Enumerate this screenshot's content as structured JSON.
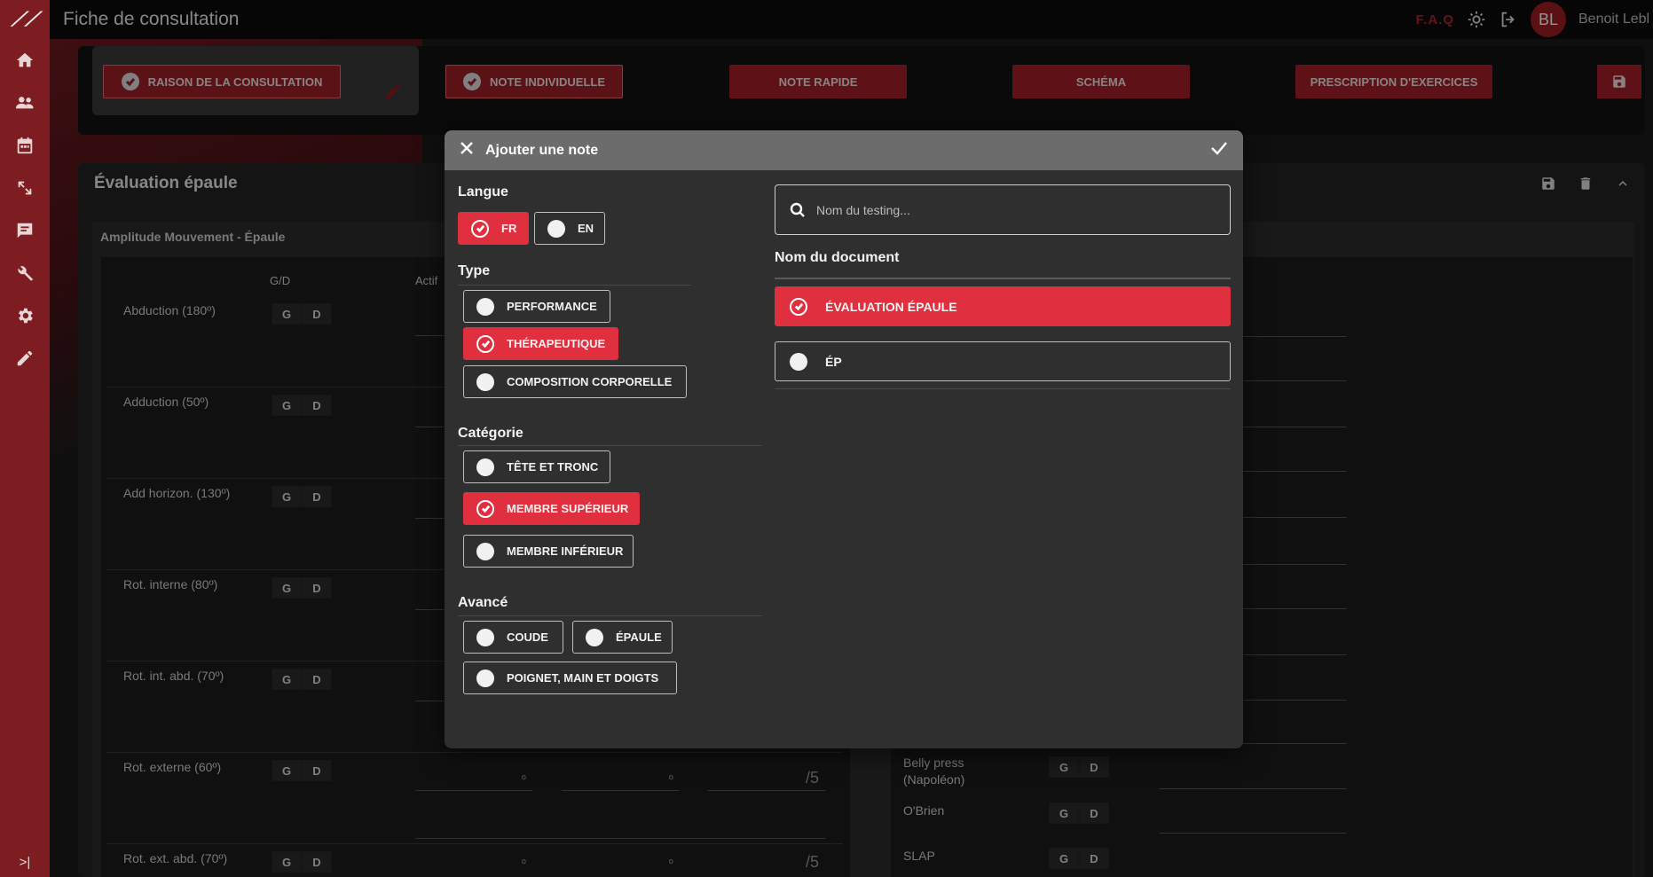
{
  "app": {
    "title": "Fiche de consultation",
    "faq": "F.A.Q",
    "user_initials": "BL",
    "user_name": "Benoit Lebl"
  },
  "sidebar": {
    "items": [
      "home-icon",
      "users-icon",
      "calendar-icon",
      "expand-icon",
      "message-icon",
      "tools-icon",
      "settings-icon",
      "pencil-icon"
    ],
    "collapse": ">|"
  },
  "toolbar": {
    "reason": "RAISON DE LA CONSULTATION",
    "note_individuelle": "NOTE INDIVIDUELLE",
    "note_rapide": "NOTE RAPIDE",
    "schema": "SCHÉMA",
    "prescription": "PRESCRIPTION D'EXERCICES"
  },
  "evaluation": {
    "title": "Évaluation épaule",
    "section": "Amplitude Mouvement - Épaule",
    "col_gd": "G/D",
    "col_actif": "Actif",
    "g": "G",
    "d": "D",
    "rows": [
      "Abduction (180º)",
      "Adduction (50º)",
      "Add horizon. (130º)",
      "Rot. interne (80º)",
      "Rot. int. abd. (70º)",
      "Rot. externe (60º)",
      "Rot. ext. abd. (70º)"
    ],
    "deg": "º",
    "score_unit": "/5",
    "right_rows": [
      "Belly press\n(Napoléon)",
      "O'Brien",
      "SLAP"
    ]
  },
  "modal": {
    "title": "Ajouter une note",
    "langue": {
      "title": "Langue",
      "options": [
        "FR",
        "EN"
      ],
      "selected": "FR"
    },
    "type": {
      "title": "Type",
      "options": [
        "PERFORMANCE",
        "THÉRAPEUTIQUE",
        "COMPOSITION CORPORELLE"
      ],
      "selected": "THÉRAPEUTIQUE"
    },
    "categorie": {
      "title": "Catégorie",
      "options": [
        "TÊTE ET TRONC",
        "MEMBRE SUPÉRIEUR",
        "MEMBRE INFÉRIEUR"
      ],
      "selected": "MEMBRE SUPÉRIEUR"
    },
    "avance": {
      "title": "Avancé",
      "options": [
        "COUDE",
        "ÉPAULE",
        "POIGNET, MAIN ET DOIGTS"
      ]
    },
    "search": {
      "placeholder": "Nom du testing..."
    },
    "documents": {
      "title": "Nom du document",
      "items": [
        "ÉVALUATION ÉPAULE",
        "ÉP"
      ],
      "selected": "ÉVALUATION ÉPAULE"
    }
  },
  "colors": {
    "brand": "#a3202a",
    "selected": "#e0303f",
    "sidebar": "#7d1d22"
  }
}
